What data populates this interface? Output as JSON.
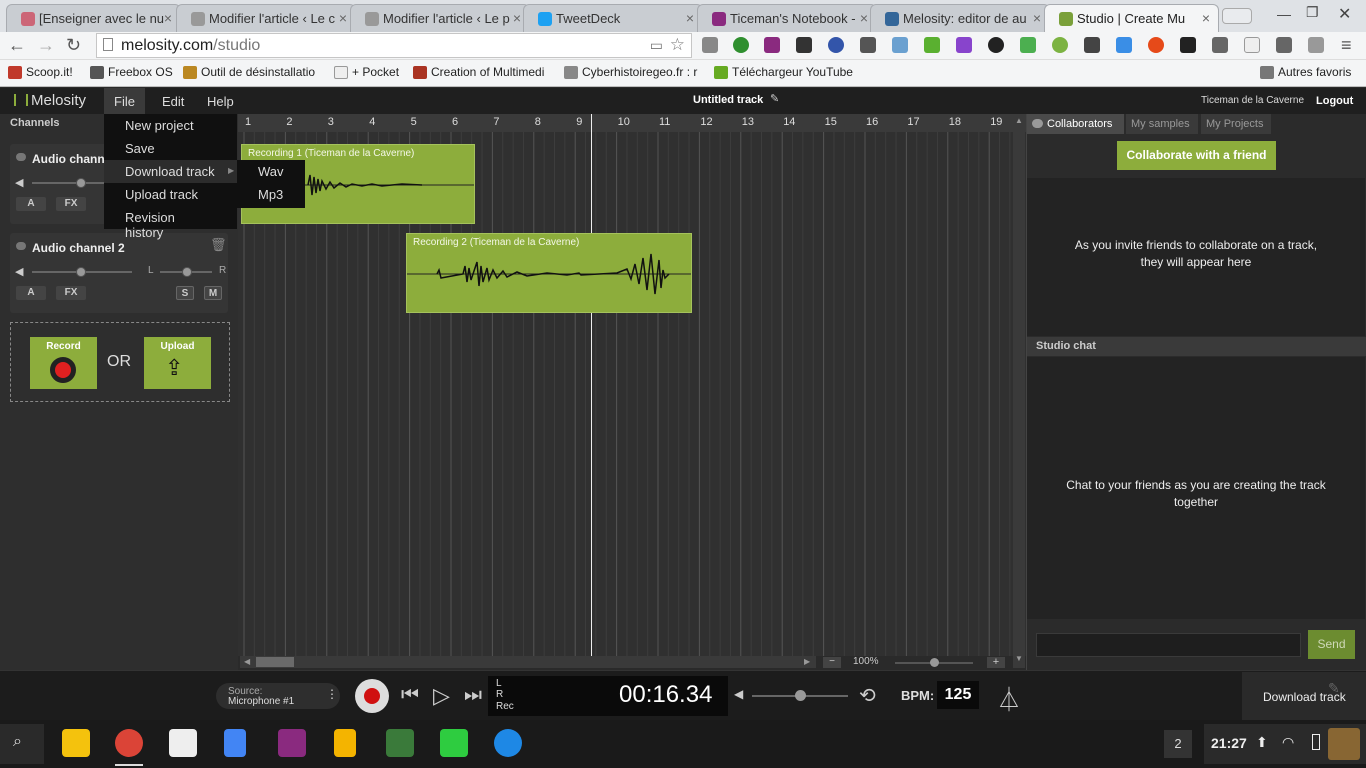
{
  "browser": {
    "tabs": [
      {
        "title": "[Enseigner avec le nu",
        "icon_color": "#cc6677"
      },
      {
        "title": "Modifier l'article ‹ Le c",
        "icon_color": "#888888"
      },
      {
        "title": "Modifier l'article ‹ Le p",
        "icon_color": "#888888"
      },
      {
        "title": "TweetDeck",
        "icon_color": "#1da1f2"
      },
      {
        "title": "Ticeman's Notebook -",
        "icon_color": "#8a2a7f"
      },
      {
        "title": "Melosity: editor de au",
        "icon_color": "#336699"
      },
      {
        "title": "Studio | Create Mu",
        "icon_color": "#7aa03a"
      }
    ],
    "url_host": "melosity.com",
    "url_path": "/studio",
    "bookmarks": [
      {
        "label": "Scoop.it!",
        "icon_color": "#c0392b"
      },
      {
        "label": "Freebox OS",
        "icon_color": "#555555"
      },
      {
        "label": "Outil de désinstallatio",
        "icon_color": "#bb8822"
      },
      {
        "label": "+ Pocket",
        "icon_color": "#eeeeee"
      },
      {
        "label": "Creation of Multimedi",
        "icon_color": "#aa3322"
      },
      {
        "label": "Cyberhistoiregeo.fr : r",
        "icon_color": "#888888"
      },
      {
        "label": "Téléchargeur YouTube",
        "icon_color": "#66aa22"
      }
    ],
    "other_bookmarks": "Autres favoris"
  },
  "app": {
    "logo": "Melosity",
    "menu": {
      "file": "File",
      "edit": "Edit",
      "help": "Help"
    },
    "track_title": "Untitled track",
    "user": "Ticeman de la Caverne",
    "logout": "Logout",
    "channels_heading": "Channels"
  },
  "file_menu": {
    "items": [
      "New project",
      "Save",
      "Download track",
      "Upload track",
      "Revision history"
    ],
    "submenu": [
      "Wav",
      "Mp3"
    ]
  },
  "channels": [
    {
      "name": "Audio channel 1",
      "a": "A",
      "fx": "FX"
    },
    {
      "name": "Audio channel 2",
      "a": "A",
      "fx": "FX",
      "pan_left": "L",
      "pan_right": "R",
      "solo": "S",
      "mute": "M"
    }
  ],
  "add_panel": {
    "record": "Record",
    "or": "OR",
    "upload": "Upload"
  },
  "ruler": [
    "1",
    "2",
    "3",
    "4",
    "5",
    "6",
    "7",
    "8",
    "9",
    "10",
    "11",
    "12",
    "13",
    "14",
    "15",
    "16",
    "17",
    "18",
    "19"
  ],
  "clips": [
    {
      "label": "Recording 1 (Ticeman de la Caverne)"
    },
    {
      "label": "Recording 2 (Ticeman de la Caverne)"
    }
  ],
  "zoom": "100%",
  "right": {
    "tabs": [
      "Collaborators",
      "My samples",
      "My Projects"
    ],
    "collab_button": "Collaborate with a friend",
    "collab_empty": "As you invite friends to collaborate on a track, they will appear here",
    "chat_heading": "Studio chat",
    "chat_empty": "Chat to your friends as you are creating the track together",
    "send": "Send"
  },
  "transport": {
    "source_label": "Source:",
    "source_value": "Microphone #1",
    "meter_l": "L",
    "meter_r": "R",
    "meter_rec": "Rec",
    "time": "00:16.34",
    "bpm_label": "BPM:",
    "bpm": "125",
    "download": "Download track"
  },
  "shelf": {
    "badge": "2",
    "clock": "21:27"
  }
}
